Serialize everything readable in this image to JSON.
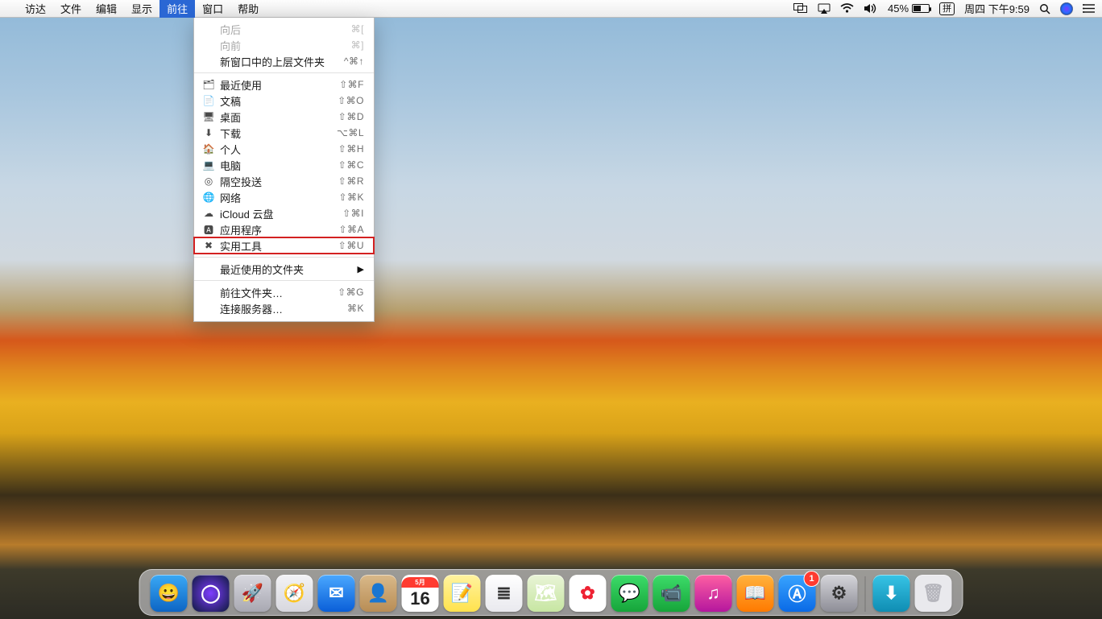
{
  "menubar": {
    "apple": "",
    "items": [
      "访达",
      "文件",
      "编辑",
      "显示",
      "前往",
      "窗口",
      "帮助"
    ],
    "open_index": 4,
    "status": {
      "battery_pct": "45%",
      "ime": "拼",
      "clock": "周四 下午9:59"
    }
  },
  "dropdown": {
    "title": "前往",
    "highlight_index": 13,
    "items": [
      {
        "type": "item",
        "disabled": true,
        "icon": "",
        "label": "向后",
        "shortcut": "⌘["
      },
      {
        "type": "item",
        "disabled": true,
        "icon": "",
        "label": "向前",
        "shortcut": "⌘]"
      },
      {
        "type": "item",
        "icon": "",
        "label": "新窗口中的上层文件夹",
        "shortcut": "^⌘↑"
      },
      {
        "type": "sep"
      },
      {
        "type": "item",
        "icon": "🗂",
        "label": "最近使用",
        "shortcut": "⇧⌘F"
      },
      {
        "type": "item",
        "icon": "📄",
        "label": "文稿",
        "shortcut": "⇧⌘O"
      },
      {
        "type": "item",
        "icon": "🖥",
        "label": "桌面",
        "shortcut": "⇧⌘D"
      },
      {
        "type": "item",
        "icon": "⬇︎",
        "label": "下载",
        "shortcut": "⌥⌘L"
      },
      {
        "type": "item",
        "icon": "🏠",
        "label": "个人",
        "shortcut": "⇧⌘H"
      },
      {
        "type": "item",
        "icon": "💻",
        "label": "电脑",
        "shortcut": "⇧⌘C"
      },
      {
        "type": "item",
        "icon": "◎",
        "label": "隔空投送",
        "shortcut": "⇧⌘R"
      },
      {
        "type": "item",
        "icon": "🌐",
        "label": "网络",
        "shortcut": "⇧⌘K"
      },
      {
        "type": "item",
        "icon": "☁︎",
        "label": "iCloud 云盘",
        "shortcut": "⇧⌘I"
      },
      {
        "type": "item",
        "icon": "🅰︎",
        "label": "应用程序",
        "shortcut": "⇧⌘A"
      },
      {
        "type": "item",
        "icon": "✖︎",
        "label": "实用工具",
        "shortcut": "⇧⌘U"
      },
      {
        "type": "sep"
      },
      {
        "type": "submenu",
        "label": "最近使用的文件夹"
      },
      {
        "type": "sep"
      },
      {
        "type": "item",
        "icon": "",
        "label": "前往文件夹…",
        "shortcut": "⇧⌘G"
      },
      {
        "type": "item",
        "icon": "",
        "label": "连接服务器…",
        "shortcut": "⌘K"
      }
    ]
  },
  "dock": {
    "items": [
      {
        "name": "finder",
        "glyph": "😀",
        "bg": "linear-gradient(#3aa9f5,#0d65c4)"
      },
      {
        "name": "siri",
        "glyph": "◯",
        "bg": "radial-gradient(circle,#7d3cff,#0e1a3c)"
      },
      {
        "name": "launchpad",
        "glyph": "🚀",
        "bg": "linear-gradient(#d8d8df,#a8a8b2)"
      },
      {
        "name": "safari",
        "glyph": "🧭",
        "bg": "linear-gradient(#f3f3f6,#d7d7de)"
      },
      {
        "name": "mail",
        "glyph": "✉︎",
        "bg": "linear-gradient(#4aa8ff,#0a5fd8)"
      },
      {
        "name": "contacts",
        "glyph": "👤",
        "bg": "linear-gradient(#d9b98a,#b88d55)"
      },
      {
        "name": "calendar",
        "glyph": "16",
        "bg": "#fff",
        "text": "#222",
        "top": "5月"
      },
      {
        "name": "notes",
        "glyph": "📝",
        "bg": "linear-gradient(#fff3a0,#ffe24d)"
      },
      {
        "name": "reminders",
        "glyph": "≣",
        "bg": "linear-gradient(#fff,#e9e9ee)",
        "text": "#333"
      },
      {
        "name": "maps",
        "glyph": "🗺",
        "bg": "linear-gradient(#e9f4d7,#c7e6a2)"
      },
      {
        "name": "photos",
        "glyph": "✿",
        "bg": "#fff",
        "text": "#e23"
      },
      {
        "name": "messages",
        "glyph": "💬",
        "bg": "linear-gradient(#3ddc6a,#16a53a)"
      },
      {
        "name": "facetime",
        "glyph": "📹",
        "bg": "linear-gradient(#3ddc6a,#16a53a)"
      },
      {
        "name": "itunes",
        "glyph": "♫",
        "bg": "linear-gradient(#ff5fa2,#b5179e)"
      },
      {
        "name": "ibooks",
        "glyph": "📖",
        "bg": "linear-gradient(#ffb23e,#ff7a00)"
      },
      {
        "name": "appstore",
        "glyph": "Ⓐ",
        "bg": "linear-gradient(#39a4ff,#0a6ae6)",
        "badge": "1"
      },
      {
        "name": "sysprefs",
        "glyph": "⚙︎",
        "bg": "linear-gradient(#d5d5da,#8e8e97)",
        "text": "#333"
      },
      {
        "name": "separator"
      },
      {
        "name": "downloads",
        "glyph": "⬇︎",
        "bg": "linear-gradient(#37c4e6,#0f8db3)"
      },
      {
        "name": "trash",
        "glyph": "🗑",
        "bg": "#e9e9ed",
        "text": "#b5b5bc"
      }
    ]
  }
}
